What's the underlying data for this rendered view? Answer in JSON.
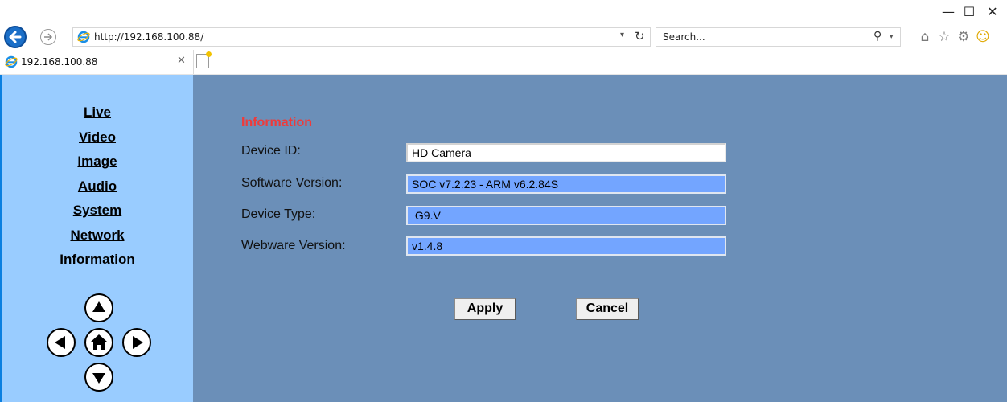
{
  "browser": {
    "window_controls": {
      "minimize": "—",
      "maximize": "☐",
      "close": "✕"
    },
    "address": "http://192.168.100.88/",
    "search_placeholder": "Search...",
    "tab_title": "192.168.100.88",
    "icons": [
      "back-arrow-icon",
      "forward-arrow-icon",
      "ie-logo-icon",
      "refresh-icon",
      "search-icon",
      "home-icon",
      "favorites-star-icon",
      "settings-gear-icon",
      "feedback-smiley-icon",
      "new-tab-icon"
    ]
  },
  "sidebar": {
    "menu": [
      {
        "label": "Live"
      },
      {
        "label": "Video"
      },
      {
        "label": "Image"
      },
      {
        "label": "Audio"
      },
      {
        "label": "System"
      },
      {
        "label": "Network"
      },
      {
        "label": "Information"
      }
    ],
    "ptz_controls": [
      "ptz-up-icon",
      "ptz-left-icon",
      "ptz-home-icon",
      "ptz-right-icon",
      "ptz-down-icon"
    ]
  },
  "main": {
    "section_title": "Information",
    "fields": [
      {
        "label": "Device ID:",
        "value": "HD Camera",
        "editable": true
      },
      {
        "label": "Software Version:",
        "value": "SOC v7.2.23 - ARM v6.2.84S",
        "editable": false
      },
      {
        "label": "Device Type:",
        "value": " G9.V",
        "editable": false
      },
      {
        "label": "Webware Version:",
        "value": "v1.4.8",
        "editable": false
      }
    ],
    "apply_label": "Apply",
    "cancel_label": "Cancel"
  },
  "colors": {
    "sidebar_bg": "#99ccff",
    "main_bg": "#6b8fb8",
    "section_title": "#ee3b3b",
    "readonly_field": "#73a5ff"
  }
}
